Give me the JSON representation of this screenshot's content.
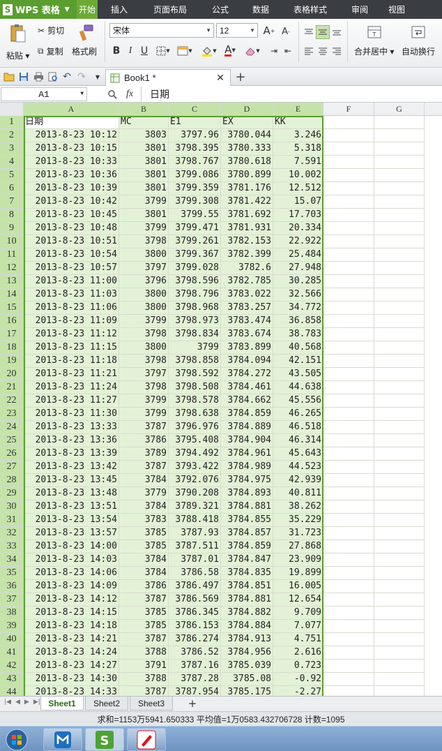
{
  "app": {
    "name": "WPS 表格"
  },
  "menu_tabs": [
    "开始",
    "插入",
    "页面布局",
    "公式",
    "数据",
    "表格样式",
    "审阅",
    "视图"
  ],
  "active_menu_tab": "开始",
  "ribbon": {
    "paste": "粘贴",
    "cut": "剪切",
    "copy": "复制",
    "format_painter": "格式刷",
    "font_name": "宋体",
    "font_size": "12",
    "merge_center": "合并居中",
    "wrap_text": "自动换行"
  },
  "document": {
    "tab_title": "Book1 *"
  },
  "formula_bar": {
    "name_box": "A1",
    "fx": "fx",
    "content": "日期"
  },
  "columns": [
    "A",
    "B",
    "C",
    "D",
    "E",
    "F",
    "G"
  ],
  "table": {
    "header": [
      "日期",
      "MC",
      "E1",
      "EX",
      "KK"
    ],
    "rows": [
      [
        "2013-8-23 10:12",
        "3803",
        "3797.96",
        "3780.044",
        "3.246"
      ],
      [
        "2013-8-23 10:15",
        "3801",
        "3798.395",
        "3780.333",
        "5.318"
      ],
      [
        "2013-8-23 10:33",
        "3801",
        "3798.767",
        "3780.618",
        "7.591"
      ],
      [
        "2013-8-23 10:36",
        "3801",
        "3799.086",
        "3780.899",
        "10.002"
      ],
      [
        "2013-8-23 10:39",
        "3801",
        "3799.359",
        "3781.176",
        "12.512"
      ],
      [
        "2013-8-23 10:42",
        "3799",
        "3799.308",
        "3781.422",
        "15.07"
      ],
      [
        "2013-8-23 10:45",
        "3801",
        "3799.55",
        "3781.692",
        "17.703"
      ],
      [
        "2013-8-23 10:48",
        "3799",
        "3799.471",
        "3781.931",
        "20.334"
      ],
      [
        "2013-8-23 10:51",
        "3798",
        "3799.261",
        "3782.153",
        "22.922"
      ],
      [
        "2013-8-23 10:54",
        "3800",
        "3799.367",
        "3782.399",
        "25.484"
      ],
      [
        "2013-8-23 10:57",
        "3797",
        "3799.028",
        "3782.6",
        "27.948"
      ],
      [
        "2013-8-23 11:00",
        "3796",
        "3798.596",
        "3782.785",
        "30.285"
      ],
      [
        "2013-8-23 11:03",
        "3800",
        "3798.796",
        "3783.022",
        "32.566"
      ],
      [
        "2013-8-23 11:06",
        "3800",
        "3798.968",
        "3783.257",
        "34.772"
      ],
      [
        "2013-8-23 11:09",
        "3799",
        "3798.973",
        "3783.474",
        "36.858"
      ],
      [
        "2013-8-23 11:12",
        "3798",
        "3798.834",
        "3783.674",
        "38.783"
      ],
      [
        "2013-8-23 11:15",
        "3800",
        "3799",
        "3783.899",
        "40.568"
      ],
      [
        "2013-8-23 11:18",
        "3798",
        "3798.858",
        "3784.094",
        "42.151"
      ],
      [
        "2013-8-23 11:21",
        "3797",
        "3798.592",
        "3784.272",
        "43.505"
      ],
      [
        "2013-8-23 11:24",
        "3798",
        "3798.508",
        "3784.461",
        "44.638"
      ],
      [
        "2013-8-23 11:27",
        "3799",
        "3798.578",
        "3784.662",
        "45.556"
      ],
      [
        "2013-8-23 11:30",
        "3799",
        "3798.638",
        "3784.859",
        "46.265"
      ],
      [
        "2013-8-23 13:33",
        "3787",
        "3796.976",
        "3784.889",
        "46.518"
      ],
      [
        "2013-8-23 13:36",
        "3786",
        "3795.408",
        "3784.904",
        "46.314"
      ],
      [
        "2013-8-23 13:39",
        "3789",
        "3794.492",
        "3784.961",
        "45.643"
      ],
      [
        "2013-8-23 13:42",
        "3787",
        "3793.422",
        "3784.989",
        "44.523"
      ],
      [
        "2013-8-23 13:45",
        "3784",
        "3792.076",
        "3784.975",
        "42.939"
      ],
      [
        "2013-8-23 13:48",
        "3779",
        "3790.208",
        "3784.893",
        "40.811"
      ],
      [
        "2013-8-23 13:51",
        "3784",
        "3789.321",
        "3784.881",
        "38.262"
      ],
      [
        "2013-8-23 13:54",
        "3783",
        "3788.418",
        "3784.855",
        "35.229"
      ],
      [
        "2013-8-23 13:57",
        "3785",
        "3787.93",
        "3784.857",
        "31.723"
      ],
      [
        "2013-8-23 14:00",
        "3785",
        "3787.511",
        "3784.859",
        "27.868"
      ],
      [
        "2013-8-23 14:03",
        "3784",
        "3787.01",
        "3784.847",
        "23.909"
      ],
      [
        "2013-8-23 14:06",
        "3784",
        "3786.58",
        "3784.835",
        "19.899"
      ],
      [
        "2013-8-23 14:09",
        "3786",
        "3786.497",
        "3784.851",
        "16.005"
      ],
      [
        "2013-8-23 14:12",
        "3787",
        "3786.569",
        "3784.881",
        "12.654"
      ],
      [
        "2013-8-23 14:15",
        "3785",
        "3786.345",
        "3784.882",
        "9.709"
      ],
      [
        "2013-8-23 14:18",
        "3785",
        "3786.153",
        "3784.884",
        "7.077"
      ],
      [
        "2013-8-23 14:21",
        "3787",
        "3786.274",
        "3784.913",
        "4.751"
      ],
      [
        "2013-8-23 14:24",
        "3788",
        "3786.52",
        "3784.956",
        "2.616"
      ],
      [
        "2013-8-23 14:27",
        "3791",
        "3787.16",
        "3785.039",
        "0.723"
      ],
      [
        "2013-8-23 14:30",
        "3788",
        "3787.28",
        "3785.08",
        "-0.92"
      ],
      [
        "2013-8-23 14:33",
        "3787",
        "3787.954",
        "3785.175",
        "-2.27"
      ]
    ]
  },
  "sheets": [
    "Sheet1",
    "Sheet2",
    "Sheet3"
  ],
  "active_sheet": "Sheet1",
  "status": {
    "text": "求和=1153万5941.650333  平均值=1万0583.432706728  计数=1095"
  },
  "colors": {
    "accent": "#5a9e2f",
    "selection_fill": "#e3f2d6",
    "header_selected": "#c5e3a9"
  }
}
